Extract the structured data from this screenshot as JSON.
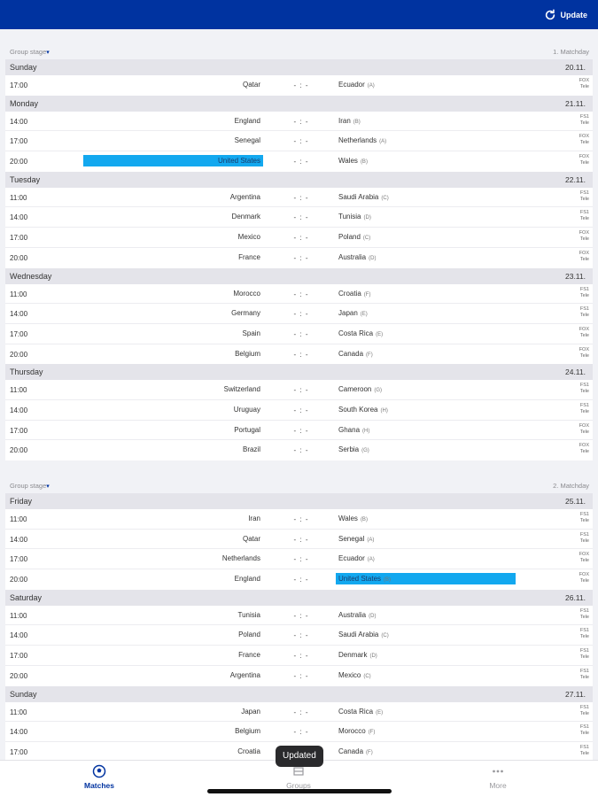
{
  "header": {
    "update_label": "Update",
    "update_icon": "refresh-icon"
  },
  "matchdays": [
    {
      "stage_label": "Group stage",
      "matchday_label": "1. Matchday",
      "days": [
        {
          "name": "Sunday",
          "date": "20.11.",
          "matches": [
            {
              "time": "17:00",
              "home": "Qatar",
              "home_group": "",
              "away": "Ecuador",
              "away_group": "(A)",
              "score": "- : -",
              "tv": "FOX\nTele",
              "hl_home": false,
              "hl_away": false
            }
          ]
        },
        {
          "name": "Monday",
          "date": "21.11.",
          "matches": [
            {
              "time": "14:00",
              "home": "England",
              "home_group": "",
              "away": "Iran",
              "away_group": "(B)",
              "score": "- : -",
              "tv": "FS1\nTele",
              "hl_home": false,
              "hl_away": false
            },
            {
              "time": "17:00",
              "home": "Senegal",
              "home_group": "",
              "away": "Netherlands",
              "away_group": "(A)",
              "score": "- : -",
              "tv": "FOX\nTele",
              "hl_home": false,
              "hl_away": false
            },
            {
              "time": "20:00",
              "home": "United States",
              "home_group": "",
              "away": "Wales",
              "away_group": "(B)",
              "score": "- : -",
              "tv": "FOX\nTele",
              "hl_home": true,
              "hl_away": false
            }
          ]
        },
        {
          "name": "Tuesday",
          "date": "22.11.",
          "matches": [
            {
              "time": "11:00",
              "home": "Argentina",
              "home_group": "",
              "away": "Saudi Arabia",
              "away_group": "(C)",
              "score": "- : -",
              "tv": "FS1\nTele",
              "hl_home": false,
              "hl_away": false
            },
            {
              "time": "14:00",
              "home": "Denmark",
              "home_group": "",
              "away": "Tunisia",
              "away_group": "(D)",
              "score": "- : -",
              "tv": "FS1\nTele",
              "hl_home": false,
              "hl_away": false
            },
            {
              "time": "17:00",
              "home": "Mexico",
              "home_group": "",
              "away": "Poland",
              "away_group": "(C)",
              "score": "- : -",
              "tv": "FOX\nTele",
              "hl_home": false,
              "hl_away": false
            },
            {
              "time": "20:00",
              "home": "France",
              "home_group": "",
              "away": "Australia",
              "away_group": "(D)",
              "score": "- : -",
              "tv": "FOX\nTele",
              "hl_home": false,
              "hl_away": false
            }
          ]
        },
        {
          "name": "Wednesday",
          "date": "23.11.",
          "matches": [
            {
              "time": "11:00",
              "home": "Morocco",
              "home_group": "",
              "away": "Croatia",
              "away_group": "(F)",
              "score": "- : -",
              "tv": "FS1\nTele",
              "hl_home": false,
              "hl_away": false
            },
            {
              "time": "14:00",
              "home": "Germany",
              "home_group": "",
              "away": "Japan",
              "away_group": "(E)",
              "score": "- : -",
              "tv": "FS1\nTele",
              "hl_home": false,
              "hl_away": false
            },
            {
              "time": "17:00",
              "home": "Spain",
              "home_group": "",
              "away": "Costa Rica",
              "away_group": "(E)",
              "score": "- : -",
              "tv": "FOX\nTele",
              "hl_home": false,
              "hl_away": false
            },
            {
              "time": "20:00",
              "home": "Belgium",
              "home_group": "",
              "away": "Canada",
              "away_group": "(F)",
              "score": "- : -",
              "tv": "FOX\nTele",
              "hl_home": false,
              "hl_away": false
            }
          ]
        },
        {
          "name": "Thursday",
          "date": "24.11.",
          "matches": [
            {
              "time": "11:00",
              "home": "Switzerland",
              "home_group": "",
              "away": "Cameroon",
              "away_group": "(G)",
              "score": "- : -",
              "tv": "FS1\nTele",
              "hl_home": false,
              "hl_away": false
            },
            {
              "time": "14:00",
              "home": "Uruguay",
              "home_group": "",
              "away": "South Korea",
              "away_group": "(H)",
              "score": "- : -",
              "tv": "FS1\nTele",
              "hl_home": false,
              "hl_away": false
            },
            {
              "time": "17:00",
              "home": "Portugal",
              "home_group": "",
              "away": "Ghana",
              "away_group": "(H)",
              "score": "- : -",
              "tv": "FOX\nTele",
              "hl_home": false,
              "hl_away": false
            },
            {
              "time": "20:00",
              "home": "Brazil",
              "home_group": "",
              "away": "Serbia",
              "away_group": "(G)",
              "score": "- : -",
              "tv": "FOX\nTele",
              "hl_home": false,
              "hl_away": false
            }
          ]
        }
      ]
    },
    {
      "stage_label": "Group stage",
      "matchday_label": "2. Matchday",
      "days": [
        {
          "name": "Friday",
          "date": "25.11.",
          "matches": [
            {
              "time": "11:00",
              "home": "Iran",
              "home_group": "",
              "away": "Wales",
              "away_group": "(B)",
              "score": "- : -",
              "tv": "FS1\nTele",
              "hl_home": false,
              "hl_away": false
            },
            {
              "time": "14:00",
              "home": "Qatar",
              "home_group": "",
              "away": "Senegal",
              "away_group": "(A)",
              "score": "- : -",
              "tv": "FS1\nTele",
              "hl_home": false,
              "hl_away": false
            },
            {
              "time": "17:00",
              "home": "Netherlands",
              "home_group": "",
              "away": "Ecuador",
              "away_group": "(A)",
              "score": "- : -",
              "tv": "FOX\nTele",
              "hl_home": false,
              "hl_away": false
            },
            {
              "time": "20:00",
              "home": "England",
              "home_group": "",
              "away": "United States",
              "away_group": "(B)",
              "score": "- : -",
              "tv": "FOX\nTele",
              "hl_home": false,
              "hl_away": true
            }
          ]
        },
        {
          "name": "Saturday",
          "date": "26.11.",
          "matches": [
            {
              "time": "11:00",
              "home": "Tunisia",
              "home_group": "",
              "away": "Australia",
              "away_group": "(D)",
              "score": "- : -",
              "tv": "FS1\nTele",
              "hl_home": false,
              "hl_away": false
            },
            {
              "time": "14:00",
              "home": "Poland",
              "home_group": "",
              "away": "Saudi Arabia",
              "away_group": "(C)",
              "score": "- : -",
              "tv": "FS1\nTele",
              "hl_home": false,
              "hl_away": false
            },
            {
              "time": "17:00",
              "home": "France",
              "home_group": "",
              "away": "Denmark",
              "away_group": "(D)",
              "score": "- : -",
              "tv": "FS1\nTele",
              "hl_home": false,
              "hl_away": false
            },
            {
              "time": "20:00",
              "home": "Argentina",
              "home_group": "",
              "away": "Mexico",
              "away_group": "(C)",
              "score": "- : -",
              "tv": "FS1\nTele",
              "hl_home": false,
              "hl_away": false
            }
          ]
        },
        {
          "name": "Sunday",
          "date": "27.11.",
          "matches": [
            {
              "time": "11:00",
              "home": "Japan",
              "home_group": "",
              "away": "Costa Rica",
              "away_group": "(E)",
              "score": "- : -",
              "tv": "FS1\nTele",
              "hl_home": false,
              "hl_away": false
            },
            {
              "time": "14:00",
              "home": "Belgium",
              "home_group": "",
              "away": "Morocco",
              "away_group": "(F)",
              "score": "- : -",
              "tv": "FS1\nTele",
              "hl_home": false,
              "hl_away": false
            },
            {
              "time": "17:00",
              "home": "Croatia",
              "home_group": "",
              "away": "Canada",
              "away_group": "(F)",
              "score": "- : -",
              "tv": "FS1\nTele",
              "hl_home": false,
              "hl_away": false
            }
          ]
        }
      ]
    }
  ],
  "toast": "Updated",
  "tabs": [
    {
      "label": "Matches",
      "icon": "soccer-ball-icon",
      "active": true
    },
    {
      "label": "Groups",
      "icon": "groups-table-icon",
      "active": false
    },
    {
      "label": "More",
      "icon": "more-dots-icon",
      "active": false
    }
  ],
  "colors": {
    "brand": "#0033a0",
    "highlight": "#13a8ef"
  }
}
